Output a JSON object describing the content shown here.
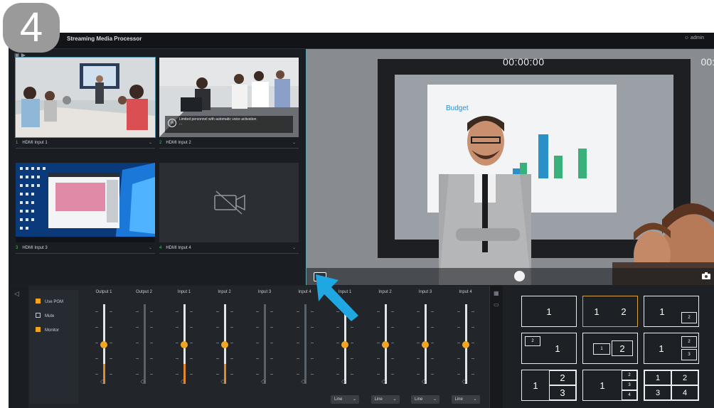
{
  "step_badge": "4",
  "window": {
    "title": "Streaming Media Processor",
    "user": "admin"
  },
  "sources": {
    "tiles": [
      {
        "num": "1",
        "label": "HDMI Input 1"
      },
      {
        "num": "2",
        "label": "HDMI Input 2",
        "caption_line1": "Limited personnel with automatic voice activation",
        "caption_line2": "..."
      },
      {
        "num": "3",
        "label": "HDMI Input 3"
      },
      {
        "num": "4",
        "label": "HDMI Input 4"
      }
    ]
  },
  "program": {
    "timer": "00:00:00",
    "timer2": "00:"
  },
  "mixer": {
    "options": [
      {
        "label": "Use PGM",
        "checked": true
      },
      {
        "label": "Mute",
        "checked": false
      },
      {
        "label": "Monitor",
        "checked": true
      }
    ],
    "channels": [
      {
        "label": "Output 1",
        "lit": true,
        "level": 0.25
      },
      {
        "label": "Output 2",
        "lit": false,
        "level": 0
      },
      {
        "label": "Input 1",
        "lit": true,
        "level": 0.25
      },
      {
        "label": "Input 2",
        "lit": true,
        "level": 0.25
      },
      {
        "label": "Input 3",
        "lit": false,
        "level": 0
      },
      {
        "label": "Input 4",
        "lit": false,
        "level": 0
      },
      {
        "label": "Input 1",
        "lit": true,
        "level": 0,
        "select": "Line"
      },
      {
        "label": "Input 2",
        "lit": true,
        "level": 0,
        "select": "Line"
      },
      {
        "label": "Input 3",
        "lit": true,
        "level": 0,
        "select": "Line"
      },
      {
        "label": "Input 4",
        "lit": true,
        "level": 0,
        "select": "Line"
      }
    ]
  },
  "layouts": {
    "l1": "1",
    "l2a": "1",
    "l2b": "2",
    "l3a": "1",
    "l3b": "2",
    "l4a": "2",
    "l4b": "1",
    "l5a": "1",
    "l5b": "2",
    "l6a": "1",
    "l6b": "2",
    "l6c": "3",
    "l7a": "1",
    "l7b": "2",
    "l7c": "3",
    "l8a": "1",
    "l8b": "2",
    "l8c": "3",
    "l8d": "4",
    "l9a": "1",
    "l9b": "2",
    "l9c": "3",
    "l9d": "4"
  },
  "colors": {
    "accent": "#f0a620",
    "pointer_arrow": "#1ea7e0",
    "active_border": "#4d8fa6"
  }
}
